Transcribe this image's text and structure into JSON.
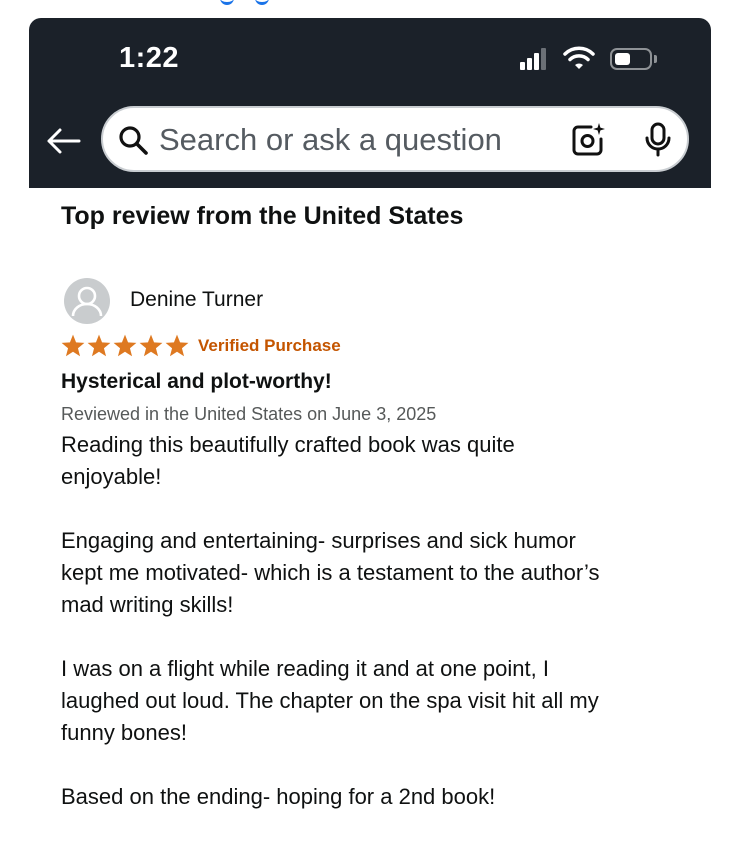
{
  "status_bar": {
    "time": "1:22",
    "icons": [
      "signal-icon",
      "wifi-icon",
      "battery-icon"
    ],
    "battery_level": 0.5
  },
  "search": {
    "placeholder": "Search or ask a question",
    "value": "",
    "icons": [
      "back-arrow-icon",
      "search-icon",
      "camera-icon",
      "mic-icon"
    ]
  },
  "review_section": {
    "title": "Top review from the United States"
  },
  "review": {
    "reviewer_name": "Denine Turner",
    "rating": 5,
    "rating_max": 5,
    "verified_label": "Verified Purchase",
    "title": "Hysterical and plot-worthy!",
    "meta": "Reviewed in the United States on June 3, 2025",
    "paragraphs": [
      "Reading this beautifully crafted book was quite\nenjoyable!",
      "Engaging and entertaining- surprises and sick humor\nkept me motivated- which is a testament to the author’s\nmad writing skills!",
      "I was on a flight while reading it and at one point, I\nlaughed out loud. The chapter on the spa visit hit all my\nfunny bones!",
      "Based on the ending- hoping for a 2nd book!"
    ]
  },
  "colors": {
    "header_bg": "#1b2129",
    "star": "#de7921",
    "verified": "#c45500",
    "text": "#0f1111",
    "meta_text": "#565959"
  }
}
